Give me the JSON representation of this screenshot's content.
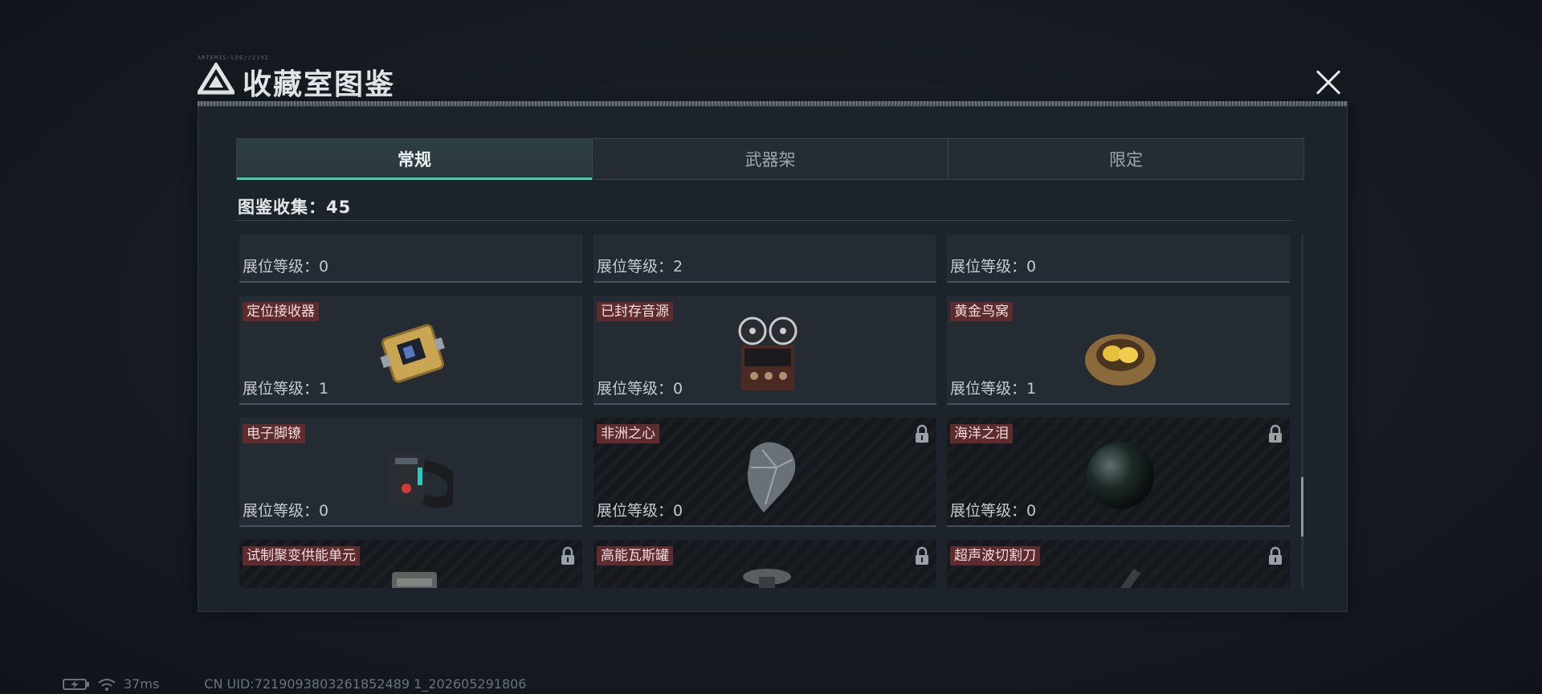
{
  "header": {
    "small_text": "ARTEMIS-LOG//2192",
    "title": "收藏室图鉴",
    "close_label": "close"
  },
  "tabs": [
    {
      "label": "常规",
      "active": true
    },
    {
      "label": "武器架",
      "active": false
    },
    {
      "label": "限定",
      "active": false
    }
  ],
  "collection": {
    "label": "图鉴收集：",
    "count": "45"
  },
  "level_label": "展位等级：",
  "items": [
    {
      "name": "",
      "level": "0",
      "locked": false,
      "icon": "key-cutter-icon"
    },
    {
      "name": "",
      "level": "2",
      "locked": false,
      "icon": "map-icon"
    },
    {
      "name": "",
      "level": "0",
      "locked": false,
      "icon": "gold-frame-painting-icon"
    },
    {
      "name": "定位接收器",
      "level": "1",
      "locked": false,
      "icon": "receiver-device-icon"
    },
    {
      "name": "已封存音源",
      "level": "0",
      "locked": false,
      "icon": "reel-tape-recorder-icon"
    },
    {
      "name": "黄金鸟窝",
      "level": "1",
      "locked": false,
      "icon": "golden-nest-icon"
    },
    {
      "name": "电子脚镣",
      "level": "0",
      "locked": false,
      "icon": "ankle-monitor-icon"
    },
    {
      "name": "非洲之心",
      "level": "0",
      "locked": true,
      "icon": "diamond-icon"
    },
    {
      "name": "海洋之泪",
      "level": "0",
      "locked": true,
      "icon": "black-pearl-icon"
    },
    {
      "name": "试制聚变供能单元",
      "level": "",
      "locked": true,
      "icon": "fusion-cell-icon"
    },
    {
      "name": "高能瓦斯罐",
      "level": "",
      "locked": true,
      "icon": "gas-canister-icon"
    },
    {
      "name": "超声波切割刀",
      "level": "",
      "locked": true,
      "icon": "ultrasonic-knife-icon"
    }
  ],
  "status_bar": {
    "ping": "37ms",
    "uid": "CN UID:7219093803261852489 1_202605291806"
  },
  "colors": {
    "accent": "#46d1a4",
    "name_tag_bg": "#5e2b2f",
    "panel_bg": "#1d232b"
  }
}
